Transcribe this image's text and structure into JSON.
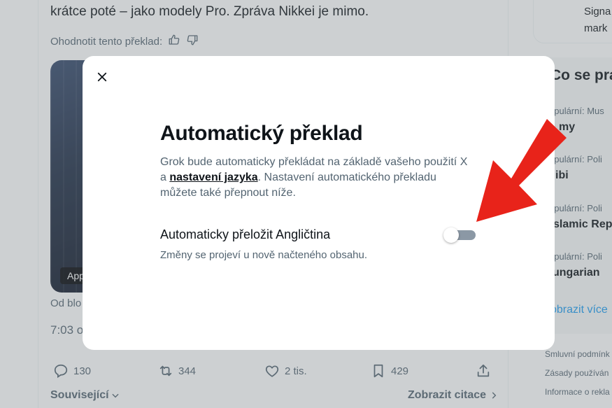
{
  "tweet": {
    "text": "krátce poté – jako modely Pro. Zpráva Nikkei je mimo.",
    "rate_label": "Ohodnotit tento překlad:",
    "media_badge": "App",
    "from_label": "Od blo",
    "time_label": "7:03 o",
    "replies": "130",
    "reposts": "344",
    "likes": "2 tis.",
    "bookmarks": "429",
    "related_label": "Související",
    "quotes_label": "Zobrazit citace"
  },
  "sidebar": {
    "signal_text": "Signa\nmark",
    "trends_title": "Co se pra",
    "trends": [
      {
        "meta": "opulární: Mus",
        "name": "my"
      },
      {
        "meta": "opulární: Poli",
        "name": "ibi"
      },
      {
        "meta": "opulární: Poli",
        "name": "slamic Rep"
      },
      {
        "meta": "opulární: Poli",
        "name": "ungarian"
      }
    ],
    "show_more": "obrazit více",
    "footer": [
      "Smluvní podmínk",
      "Zásady používán",
      "Informace o rekla"
    ]
  },
  "modal": {
    "title": "Automatický překlad",
    "desc_before": "Grok bude automaticky překládat na základě vašeho použití X a ",
    "desc_link": "nastavení jazyka",
    "desc_after": ". Nastavení automatického překladu můžete také přepnout níže.",
    "setting_label": "Automaticky přeložit Angličtina",
    "setting_hint": "Změny se projeví u nově načteného obsahu.",
    "toggle_on": false
  },
  "colors": {
    "arrow": "#e8231a",
    "link_blue": "#1d9bf0",
    "toggle_off": "#8b98a5"
  },
  "icons": [
    "close-icon",
    "thumbs-up-icon",
    "thumbs-down-icon",
    "reply-icon",
    "repost-icon",
    "like-icon",
    "bookmark-icon",
    "share-icon",
    "chevron-down-icon",
    "chevron-right-icon"
  ]
}
